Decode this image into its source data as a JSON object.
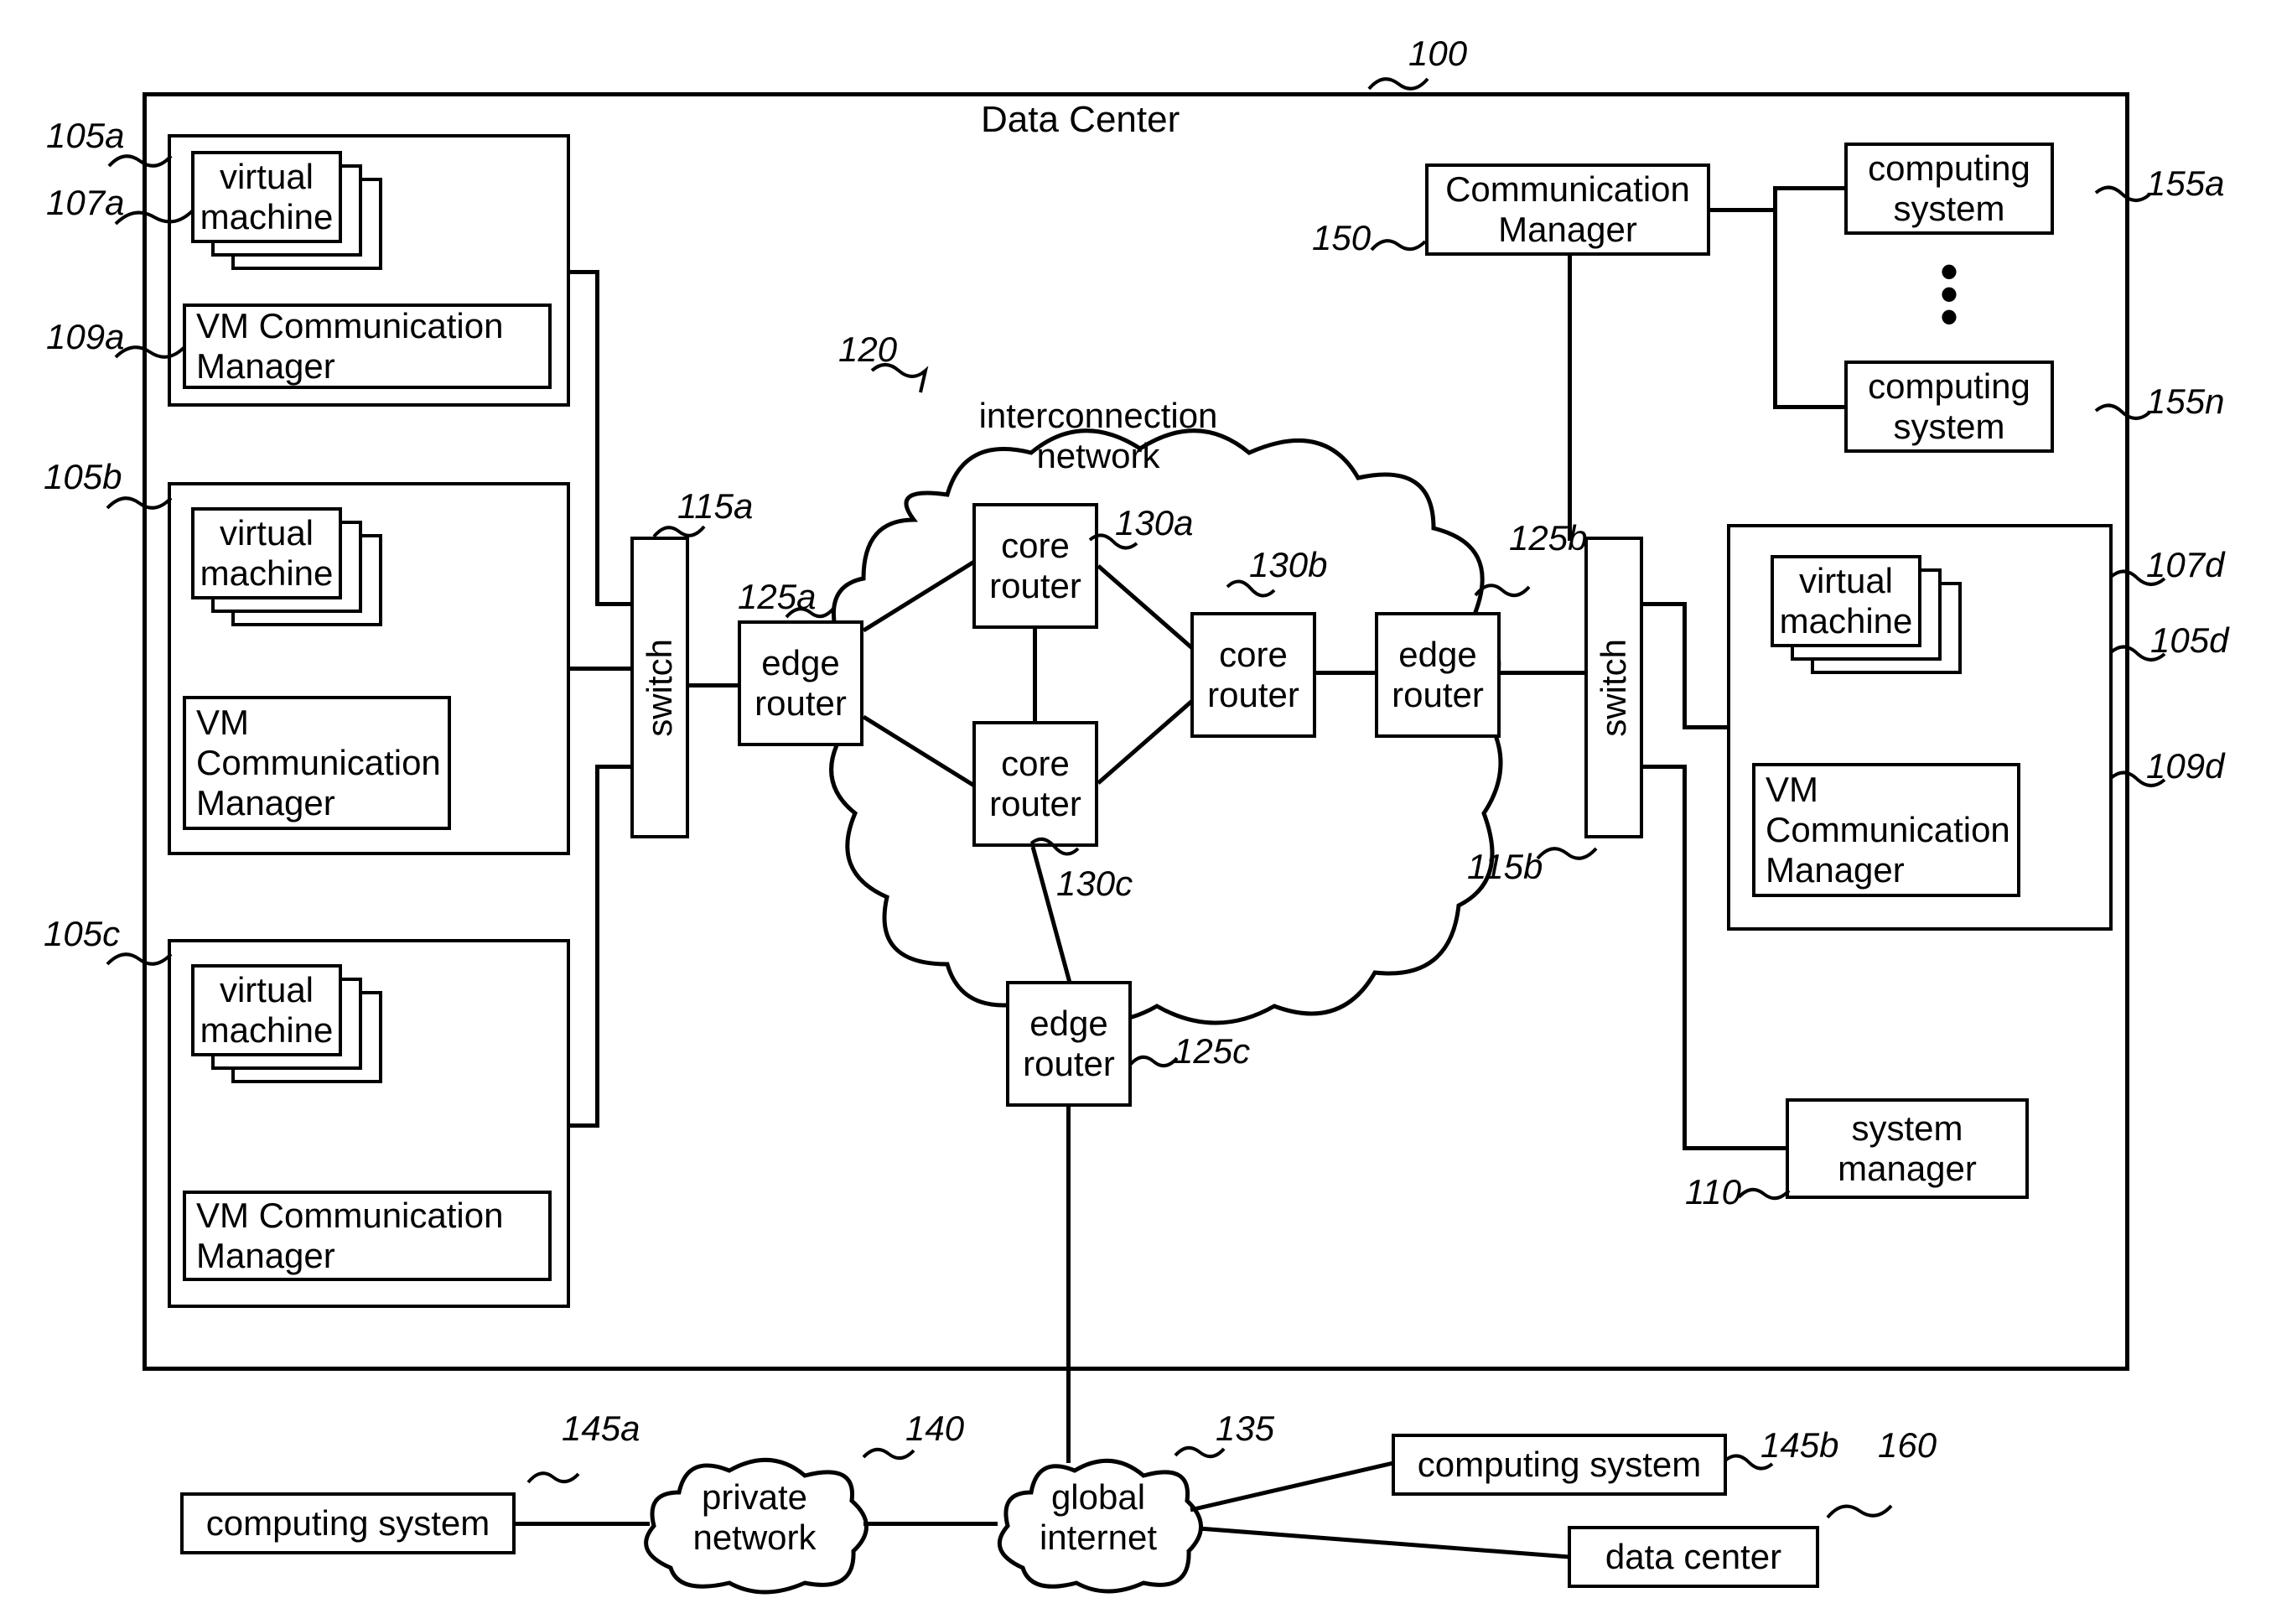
{
  "title": "Data Center",
  "refs": {
    "r100": "100",
    "r105a": "105a",
    "r107a": "107a",
    "r109a": "109a",
    "r105b": "105b",
    "r105c": "105c",
    "r115a": "115a",
    "r125a": "125a",
    "r120": "120",
    "r130a": "130a",
    "r130b": "130b",
    "r130c": "130c",
    "r125b": "125b",
    "r125c": "125c",
    "r115b": "115b",
    "r150": "150",
    "r155a": "155a",
    "r155n": "155n",
    "r107d": "107d",
    "r105d": "105d",
    "r109d": "109d",
    "r110": "110",
    "r140": "140",
    "r145a": "145a",
    "r135": "135",
    "r145b": "145b",
    "r160": "160"
  },
  "nodes": {
    "virtual_machine": "virtual\nmachine",
    "vm_comm_mgr": "VM Communication\nManager",
    "vm_comm_mgr_multi": "VM\nCommunication\nManager",
    "switch": "switch",
    "edge_router": "edge\nrouter",
    "core_router": "core\nrouter",
    "interconnection_network": "interconnection\nnetwork",
    "comm_mgr": "Communication\nManager",
    "computing_system": "computing\nsystem",
    "computing_system_flat": "computing system",
    "system_manager": "system\nmanager",
    "private_network": "private\nnetwork",
    "global_internet": "global\ninternet",
    "data_center": "data center"
  }
}
